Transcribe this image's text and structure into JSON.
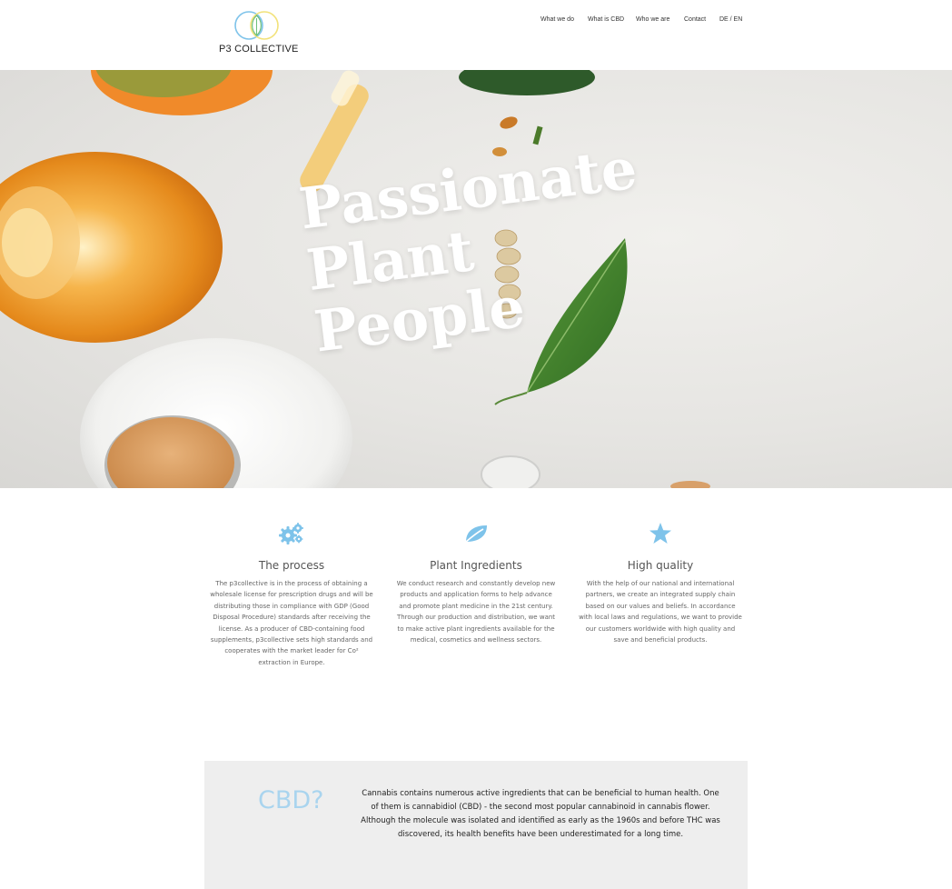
{
  "header": {
    "logo_text": "P3 COLLECTIVE",
    "nav": [
      "What we do",
      "What is CBD",
      "Who we are",
      "Contact",
      "DE / EN"
    ]
  },
  "hero": {
    "title_lines": [
      "Passionate",
      "Plant",
      "People"
    ]
  },
  "features": [
    {
      "icon": "gears-icon",
      "title": "The process",
      "text": "The p3collective is in the process of obtaining a wholesale license for prescription drugs and will be distributing those in compliance with GDP (Good Disposal Procedure) standards after receiving the license. As a producer of CBD-containing food supplements, p3collective sets high standards and cooperates with the market leader for Co² extraction in Europe."
    },
    {
      "icon": "leaf-icon",
      "title": "Plant Ingredients",
      "text": "We conduct research and constantly develop new products and application forms to help advance and promote plant medicine in the 21st century. Through our production and distribution, we want to make active plant ingredients available for the medical, cosmetics and wellness sectors."
    },
    {
      "icon": "star-icon",
      "title": "High quality",
      "text": "With the help of our national and international partners, we create an integrated supply chain based on our values and beliefs. In accordance with local laws and regulations, we want to provide our customers worldwide with high quality and save and beneficial products."
    }
  ],
  "cbd": {
    "title": "CBD?",
    "text": "Cannabis contains numerous active ingredients that can be beneficial to human health. One of them is cannabidiol (CBD) - the second most popular cannabinoid in cannabis flower. Although the molecule was isolated and identified as early as the 1960s and before THC was discovered, its health benefits have been underestimated for a long time."
  },
  "colors": {
    "accent": "#7ec3ea",
    "cbd_heading": "#a9d4ee",
    "cbd_background": "#eeeeee"
  }
}
